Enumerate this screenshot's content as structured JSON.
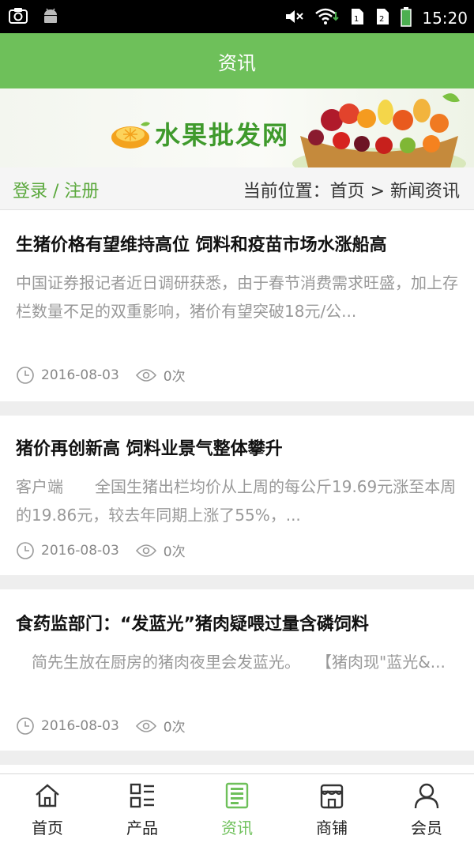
{
  "status_bar": {
    "time": "15:20"
  },
  "header": {
    "title": "资讯"
  },
  "banner": {
    "logo_text": "水果批发网"
  },
  "nav": {
    "login": "登录 / 注册",
    "breadcrumb": "当前位置：首页 > 新闻资讯"
  },
  "articles": [
    {
      "title": "生猪价格有望维持高位 饲料和疫苗市场水涨船高",
      "summary": "中国证券报记者近日调研获悉，由于春节消费需求旺盛，加上存栏数量不足的双重影响，猪价有望突破18元/公...",
      "date": "2016-08-03",
      "views": "0次"
    },
    {
      "title": "猪价再创新高 饲料业景气整体攀升",
      "summary": "客户端　　全国生猪出栏均价从上周的每公斤19.69元涨至本周的19.86元，较去年同期上涨了55%，...",
      "date": "2016-08-03",
      "views": "0次"
    },
    {
      "title": "食药监部门：“发蓝光”猪肉疑喂过量含磷饲料",
      "summary": "　简先生放在厨房的猪肉夜里会发蓝光。　　【猪肉现\"蓝光&...",
      "date": "2016-08-03",
      "views": "0次"
    }
  ],
  "tabs": [
    {
      "label": "首页",
      "icon": "home-icon"
    },
    {
      "label": "产品",
      "icon": "grid-list-icon"
    },
    {
      "label": "资讯",
      "icon": "news-icon",
      "active": true
    },
    {
      "label": "商铺",
      "icon": "shop-icon"
    },
    {
      "label": "会员",
      "icon": "user-icon"
    }
  ],
  "colors": {
    "accent": "#6ec05a",
    "login_link": "#5aa83c",
    "logo": "#3f9a2c"
  }
}
